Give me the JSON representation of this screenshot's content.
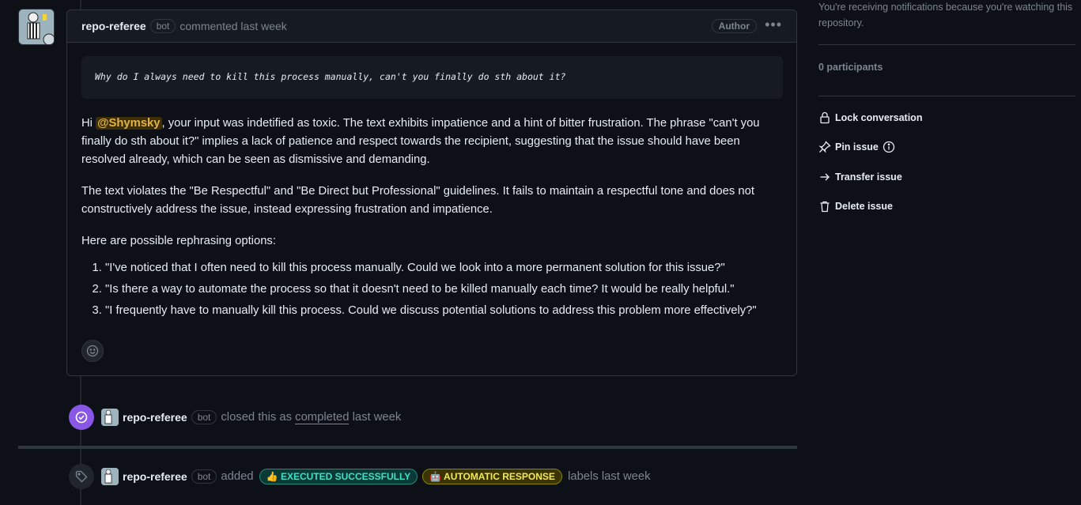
{
  "comment": {
    "author": "repo-referee",
    "bot_badge": "bot",
    "meta": "commented last week",
    "author_badge": "Author",
    "code": "Why do I always need to kill this process manually, can't you finally do sth about it?",
    "p1_prefix": "Hi ",
    "mention": "@Shymsky",
    "p1_rest": ", your input was indetified as toxic. The text exhibits impatience and a hint of bitter frustration. The phrase \"can't you finally do sth about it?\" implies a lack of patience and respect towards the recipient, suggesting that the issue should have been resolved already, which can be seen as dismissive and demanding.",
    "p2": "The text violates the \"Be Respectful\" and \"Be Direct but Professional\" guidelines. It fails to maintain a respectful tone and does not constructively address the issue, instead expressing frustration and impatience.",
    "p3": "Here are possible rephrasing options:",
    "options": [
      "\"I've noticed that I often need to kill this process manually. Could we look into a more permanent solution for this issue?\"",
      "\"Is there a way to automate the process so that it doesn't need to be killed manually each time? It would be really helpful.\"",
      "\"I frequently have to manually kill this process. Could we discuss potential solutions to address this problem more effectively?\""
    ]
  },
  "closed_event": {
    "author": "repo-referee",
    "bot_badge": "bot",
    "text_before": "closed this as",
    "link": "completed",
    "text_after": "last week"
  },
  "label_event": {
    "author": "repo-referee",
    "bot_badge": "bot",
    "text_before": "added",
    "label1": "👍 EXECUTED SUCCESSFULLY",
    "label2": "🤖 AUTOMATIC RESPONSE",
    "text_after": "labels last week"
  },
  "sidebar": {
    "notice": "You're receiving notifications because you're watching this repository.",
    "participants": "0 participants",
    "lock": "Lock conversation",
    "pin": "Pin issue",
    "transfer": "Transfer issue",
    "delete": "Delete issue"
  }
}
